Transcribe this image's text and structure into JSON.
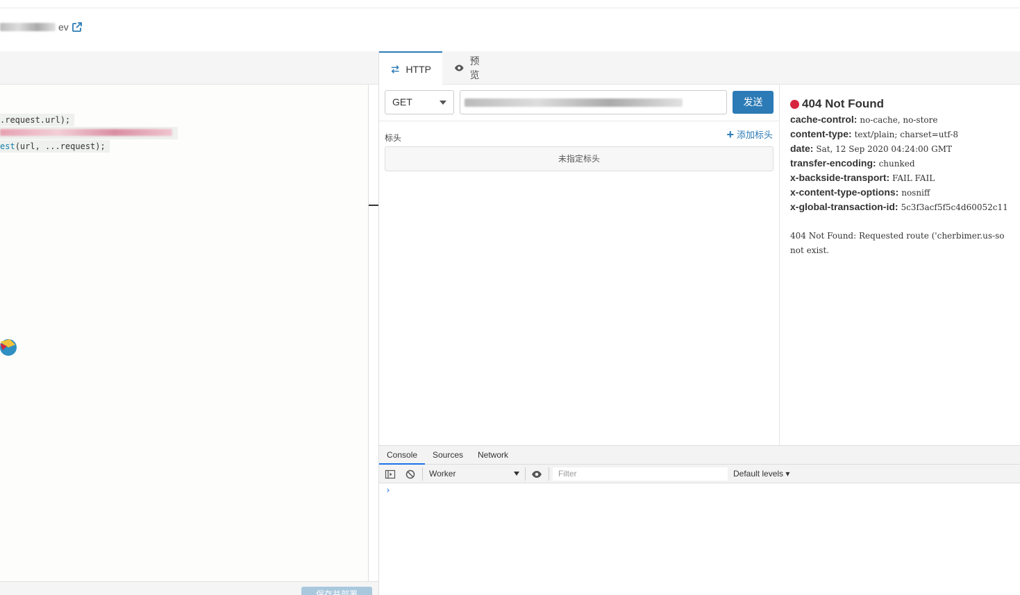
{
  "header": {
    "worker_name_suffix": "ev"
  },
  "editor": {
    "code_lines": [
      {
        "before": "",
        "fn": "",
        "text": ".request.url);"
      },
      {
        "before": "",
        "fn": "",
        "text": ""
      },
      {
        "before": "",
        "fn": "est",
        "text": "(url, ...request);"
      }
    ],
    "save_label": "保存并部署"
  },
  "tabs": [
    {
      "label": "HTTP",
      "icon": "swap-arrows-icon",
      "active": true
    },
    {
      "label": "预览",
      "icon": "eye-icon",
      "active": false
    }
  ],
  "request": {
    "method": "GET",
    "send_label": "发送",
    "headers_label": "标头",
    "add_header_label": "添加标头",
    "no_headers_label": "未指定标头"
  },
  "response": {
    "status": "404 Not Found",
    "status_color": "#d6263f",
    "headers": [
      {
        "key": "cache-control:",
        "value": "no-cache, no-store"
      },
      {
        "key": "content-type:",
        "value": "text/plain; charset=utf-8"
      },
      {
        "key": "date:",
        "value": "Sat, 12 Sep 2020 04:24:00 GMT"
      },
      {
        "key": "transfer-encoding:",
        "value": "chunked"
      },
      {
        "key": "x-backside-transport:",
        "value": "FAIL FAIL"
      },
      {
        "key": "x-content-type-options:",
        "value": "nosniff"
      },
      {
        "key": "x-global-transaction-id:",
        "value": "5c3f3acf5f5c4d60052c11"
      }
    ],
    "body_line1": "404 Not Found: Requested route ('cherbimer.us-so",
    "body_line2": "not exist."
  },
  "devtools": {
    "tabs": [
      "Console",
      "Sources",
      "Network"
    ],
    "active_tab": "Console",
    "context": "Worker",
    "filter_placeholder": "Filter",
    "levels": "Default levels ▾",
    "prompt": "›"
  },
  "colors": {
    "accent": "#2c7bb6",
    "devtools_accent": "#1a73e8"
  }
}
